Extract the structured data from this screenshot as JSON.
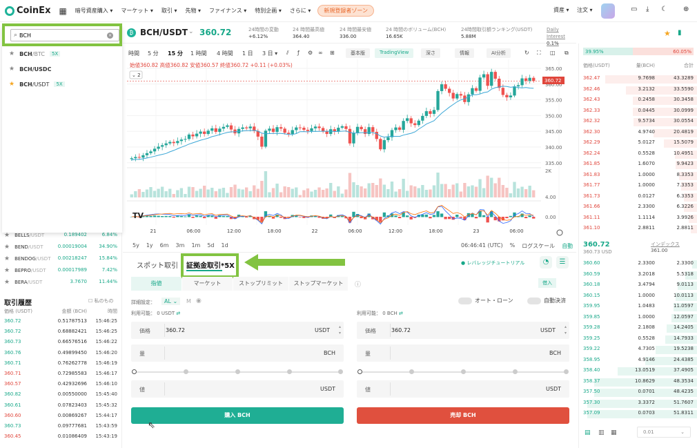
{
  "nav": {
    "logo": "CoinEx",
    "items": [
      "暗号資産購入",
      "マーケット",
      "取引",
      "先物",
      "ファイナンス",
      "特別企画",
      "さらに"
    ],
    "cta": "新規登録者ゾーン",
    "assets": "資産",
    "orders": "注文"
  },
  "search": {
    "value": "BCH",
    "results": [
      {
        "pair": "BCH",
        "quote": "/BTC",
        "badge": "5X",
        "starred": false
      },
      {
        "pair": "BCH",
        "quote": "/USDC",
        "badge": "",
        "starred": false
      },
      {
        "pair": "BCH",
        "quote": "/USDT",
        "badge": "5X",
        "starred": true
      }
    ]
  },
  "markets": [
    {
      "name": "BELLS",
      "quote": "/USDT",
      "price": "0.189402",
      "change": "6.84%"
    },
    {
      "name": "BEND",
      "quote": "/USDT",
      "price": "0.00019004",
      "change": "34.90%"
    },
    {
      "name": "BENDOG",
      "quote": "/USDT",
      "price": "0.00218247",
      "change": "15.84%"
    },
    {
      "name": "BEPRO",
      "quote": "/USDT",
      "price": "0.00017989",
      "change": "7.42%"
    },
    {
      "name": "BERA",
      "quote": "/USDT",
      "price": "3.7670",
      "change": "11.44%"
    }
  ],
  "history": {
    "title": "取引履歴",
    "mine": "私のもの",
    "cols": [
      "価格 (USDT)",
      "金額 (BCH)",
      "時間"
    ],
    "rows": [
      {
        "p": "360.72",
        "a": "0.51787513",
        "t": "15:46:25",
        "side": "buy"
      },
      {
        "p": "360.72",
        "a": "0.68882421",
        "t": "15:46:25",
        "side": "buy"
      },
      {
        "p": "360.73",
        "a": "0.66576516",
        "t": "15:46:22",
        "side": "buy"
      },
      {
        "p": "360.76",
        "a": "0.49899450",
        "t": "15:46:20",
        "side": "buy"
      },
      {
        "p": "360.71",
        "a": "0.76262778",
        "t": "15:46:19",
        "side": "buy"
      },
      {
        "p": "360.71",
        "a": "0.72985583",
        "t": "15:46:17",
        "side": "sell"
      },
      {
        "p": "360.57",
        "a": "0.42932696",
        "t": "15:46:10",
        "side": "sell"
      },
      {
        "p": "360.82",
        "a": "0.00550000",
        "t": "15:45:40",
        "side": "buy"
      },
      {
        "p": "360.61",
        "a": "0.07823403",
        "t": "15:45:32",
        "side": "buy"
      },
      {
        "p": "360.60",
        "a": "0.00869267",
        "t": "15:44:17",
        "side": "sell"
      },
      {
        "p": "360.73",
        "a": "0.09777681",
        "t": "15:43:59",
        "side": "buy"
      },
      {
        "p": "360.45",
        "a": "0.01086409",
        "t": "15:43:19",
        "side": "sell"
      }
    ]
  },
  "ticker": {
    "pair": "BCH/USDT",
    "price": "360.72",
    "stats": [
      {
        "label": "24時間の変動",
        "value": "+6.12%"
      },
      {
        "label": "24 時間最高値",
        "value": "364.40"
      },
      {
        "label": "24 時間最安値",
        "value": "336.00"
      },
      {
        "label": "24 時間のボリューム(BCH)",
        "value": "16.65K"
      },
      {
        "label": "24時間取引額ランキング(USDT)",
        "value": "5.88M"
      },
      {
        "label": "Daily Interest",
        "value": "0.1%"
      }
    ]
  },
  "toolbar": {
    "intervals": [
      "時間",
      "5 分",
      "15 分",
      "1 時間",
      "4 時間",
      "1 日",
      "3 日"
    ],
    "views": [
      "基本版",
      "TradingView",
      "深さ",
      "情報",
      "AI分析"
    ]
  },
  "chart_data": {
    "type": "candlestick",
    "ohlc_label": "始値360.82 高値360.82 安値360.57 終値360.72 +0.11 (+0.03%)",
    "price_label": "360.72",
    "yticks": [
      "365.00",
      "360.00",
      "355.00",
      "350.00",
      "345.00",
      "340.00",
      "335.00"
    ],
    "vol_ticks": [
      "2K",
      "4.00",
      "0.00"
    ],
    "xticks": [
      "21",
      "06:00",
      "12:00",
      "18:00",
      "22",
      "06:00",
      "12:00",
      "18:00",
      "23",
      "06:00"
    ],
    "closes": [
      334.6,
      335.0,
      334.8,
      335.6,
      336.3,
      336.9,
      337.8,
      338.5,
      339.0,
      339.6,
      340.1,
      339.7,
      340.4,
      340.9,
      341.1,
      342.6,
      342.0,
      342.9,
      343.6,
      342.8,
      343.9,
      344.7,
      343.5,
      344.6,
      345.2,
      345.7,
      344.3,
      343.0,
      344.5,
      345.0,
      344.7,
      345.3,
      343.8,
      341.9,
      338.5,
      343.9,
      344.6,
      343.5,
      345.1,
      344.6,
      343.2,
      342.8,
      344.1,
      345.0,
      344.9,
      344.2,
      343.8,
      344.7,
      345.3,
      344.8,
      343.6,
      342.8,
      344.4,
      343.7,
      344.9,
      345.4,
      344.5,
      339.6,
      343.2,
      345.2,
      344.4,
      342.8,
      345.1,
      343.5,
      341.1,
      337.6,
      340.7,
      341.7,
      344.1,
      345.0,
      344.2,
      347.2,
      348.1,
      346.4,
      345.8,
      347.3,
      348.9,
      350.5,
      349.6,
      350.9,
      357.3,
      359.6,
      358.1,
      356.7,
      354.8,
      356.3,
      355.8,
      353.6,
      356.2,
      358.3,
      357.4,
      361.9,
      363.0,
      359.1,
      363.8,
      361.5,
      358.4,
      356.0,
      355.2,
      355.8,
      358.9,
      359.3,
      361.6,
      360.8,
      361.8,
      360.72
    ],
    "footer_ranges": [
      "5y",
      "1y",
      "6m",
      "3m",
      "1m",
      "5d",
      "1d"
    ],
    "footer_time": "06:46:41 (UTC)",
    "footer_opts": [
      "%",
      "ログスケール",
      "自動"
    ]
  },
  "orderbook": {
    "buy_pct": "39.95%",
    "sell_pct": "60.05%",
    "cols": [
      "価格(USDT)",
      "量(BCH)",
      "合計"
    ],
    "asks": [
      [
        "362.47",
        "9.7698",
        "43.3289"
      ],
      [
        "362.46",
        "3.2132",
        "33.5590"
      ],
      [
        "362.43",
        "0.2458",
        "30.3458"
      ],
      [
        "362.33",
        "0.0445",
        "30.0999"
      ],
      [
        "362.32",
        "9.5734",
        "30.0554"
      ],
      [
        "362.30",
        "4.9740",
        "20.4819"
      ],
      [
        "362.29",
        "5.0127",
        "15.5079"
      ],
      [
        "362.24",
        "0.5528",
        "10.4951"
      ],
      [
        "361.85",
        "1.6070",
        "9.9423"
      ],
      [
        "361.83",
        "1.0000",
        "8.3353"
      ],
      [
        "361.77",
        "1.0000",
        "7.3353"
      ],
      [
        "361.73",
        "0.0127",
        "6.3353"
      ],
      [
        "361.66",
        "2.3300",
        "6.3226"
      ],
      [
        "361.11",
        "1.1114",
        "3.9926"
      ],
      [
        "361.10",
        "2.8811",
        "2.8811"
      ]
    ],
    "last_price": "360.72",
    "last_sub": "360.73",
    "last_sub_unit": "USD",
    "index_label": "インデックス",
    "index_value": "361.00",
    "bids": [
      [
        "360.60",
        "2.3300",
        "2.3300"
      ],
      [
        "360.59",
        "3.2018",
        "5.5318"
      ],
      [
        "360.18",
        "3.4794",
        "9.0113"
      ],
      [
        "360.15",
        "1.0000",
        "10.0113"
      ],
      [
        "359.95",
        "1.0483",
        "11.0597"
      ],
      [
        "359.85",
        "1.0000",
        "12.0597"
      ],
      [
        "359.28",
        "2.1808",
        "14.2405"
      ],
      [
        "359.25",
        "0.5528",
        "14.7933"
      ],
      [
        "359.22",
        "4.7305",
        "19.5238"
      ],
      [
        "358.95",
        "4.9146",
        "24.4385"
      ],
      [
        "358.40",
        "13.0519",
        "37.4905"
      ],
      [
        "358.37",
        "10.8629",
        "48.3534"
      ],
      [
        "357.50",
        "0.0701",
        "48.4235"
      ],
      [
        "357.30",
        "3.3372",
        "51.7607"
      ],
      [
        "357.09",
        "0.0703",
        "51.8311"
      ]
    ],
    "depth": "0.01"
  },
  "trade": {
    "tabs": [
      "スポット取引",
      "証拠金取引*5X"
    ],
    "tutorial": "レバレッジチュートリアル",
    "order_types": [
      "指値",
      "マーケット",
      "ストップリミット",
      "ストップマーケット"
    ],
    "borrow": "借入",
    "detail_label": "詳細設定：",
    "detail_value": "AL",
    "detail_m": "M",
    "auto_loan": "オート・ローン",
    "auto_repay": "自動決済",
    "buy_avail_label": "利用可能：",
    "buy_avail": "0 USDT",
    "sell_avail_label": "利用可能：",
    "sell_avail": "0 BCH",
    "price_label": "価格",
    "qty_label": "量",
    "value_label": "値",
    "price_value": "360.72",
    "usdt": "USDT",
    "bch": "BCH",
    "buy_button": "購入 BCH",
    "sell_button": "売却 BCH"
  }
}
